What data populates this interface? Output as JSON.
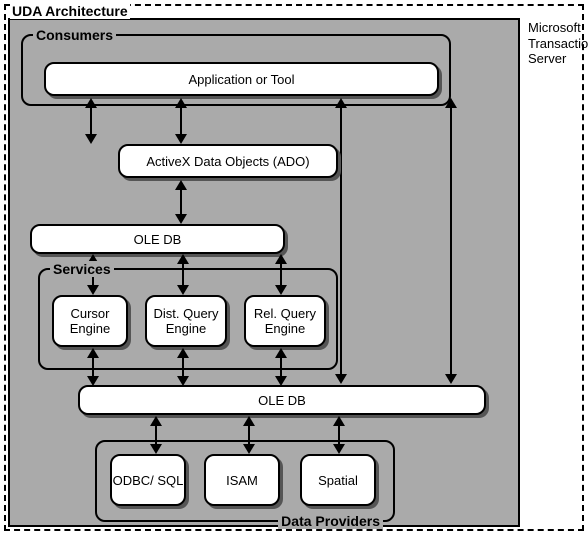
{
  "title": "UDA Architecture",
  "sideLabel": "Microsoft\nTransaction\nServer",
  "groups": {
    "consumers": "Consumers",
    "services": "Services",
    "providers": "Data Providers"
  },
  "components": {
    "appTool": "Application or Tool",
    "ado": "ActiveX Data Objects (ADO)",
    "oledb1": "OLE DB",
    "cursor": "Cursor Engine",
    "distQuery": "Dist. Query Engine",
    "relQuery": "Rel. Query Engine",
    "oledb2": "OLE DB",
    "odbc": "ODBC/ SQL",
    "isam": "ISAM",
    "spatial": "Spatial"
  },
  "chart_data": {
    "type": "diagram-architecture",
    "title": "UDA Architecture",
    "outer_context": "Microsoft Transaction Server",
    "nodes": [
      {
        "id": "app",
        "label": "Application or Tool",
        "group": "Consumers"
      },
      {
        "id": "ado",
        "label": "ActiveX Data Objects (ADO)"
      },
      {
        "id": "oledb_upper",
        "label": "OLE DB"
      },
      {
        "id": "cursor",
        "label": "Cursor Engine",
        "group": "Services"
      },
      {
        "id": "distq",
        "label": "Dist. Query Engine",
        "group": "Services"
      },
      {
        "id": "relq",
        "label": "Rel. Query Engine",
        "group": "Services"
      },
      {
        "id": "oledb_lower",
        "label": "OLE DB"
      },
      {
        "id": "odbc",
        "label": "ODBC/SQL",
        "group": "Data Providers"
      },
      {
        "id": "isam",
        "label": "ISAM",
        "group": "Data Providers"
      },
      {
        "id": "spatial",
        "label": "Spatial",
        "group": "Data Providers"
      }
    ],
    "edges_bidirectional": [
      [
        "app",
        "ado"
      ],
      [
        "app",
        "oledb_lower"
      ],
      [
        "ado",
        "oledb_upper"
      ],
      [
        "oledb_upper",
        "cursor"
      ],
      [
        "oledb_upper",
        "distq"
      ],
      [
        "oledb_upper",
        "relq"
      ],
      [
        "cursor",
        "oledb_lower"
      ],
      [
        "distq",
        "oledb_lower"
      ],
      [
        "relq",
        "oledb_lower"
      ],
      [
        "oledb_lower",
        "odbc"
      ],
      [
        "oledb_lower",
        "isam"
      ],
      [
        "oledb_lower",
        "spatial"
      ]
    ],
    "groups": [
      "Consumers",
      "Services",
      "Data Providers"
    ]
  }
}
